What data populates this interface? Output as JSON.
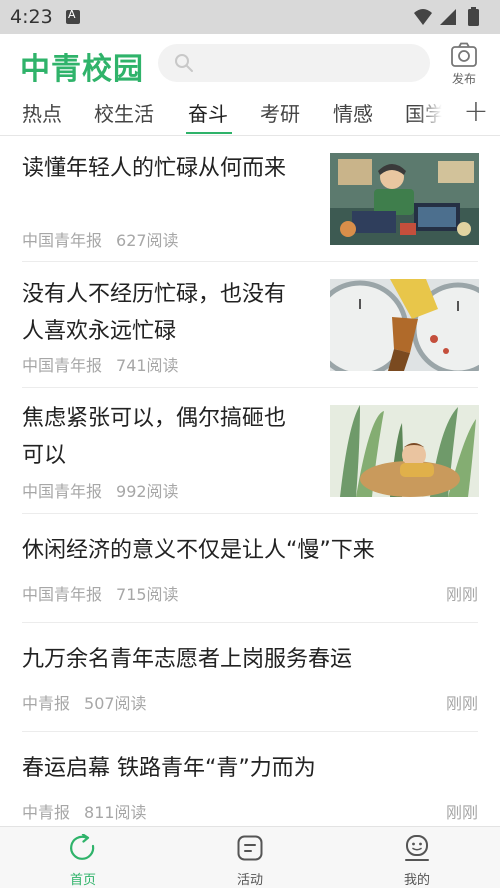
{
  "status_bar": {
    "time": "4:23"
  },
  "header": {
    "logo": "中青校园",
    "search_placeholder": "",
    "publish_label": "发布"
  },
  "tabs": [
    {
      "label": "热点"
    },
    {
      "label": "校生活"
    },
    {
      "label": "奋斗"
    },
    {
      "label": "考研"
    },
    {
      "label": "情感"
    },
    {
      "label": "国学"
    }
  ],
  "active_tab": "奋斗",
  "tab_add_label": "+",
  "articles": [
    {
      "title_lines": [
        "读懂年轻人的忙碌从何而来"
      ],
      "source": "中国青年报",
      "reads": "627阅读",
      "time": "",
      "has_image": true,
      "image": "illustration-desk-work"
    },
    {
      "title_lines": [
        "没有人不经历忙碌，也没有",
        "人喜欢永远忙碌"
      ],
      "source": "中国青年报",
      "reads": "741阅读",
      "time": "",
      "has_image": true,
      "image": "illustration-clock-person"
    },
    {
      "title_lines": [
        "焦虑紧张可以，偶尔搞砸也",
        "可以"
      ],
      "source": "中国青年报",
      "reads": "992阅读",
      "time": "",
      "has_image": true,
      "image": "illustration-relaxing-basket"
    },
    {
      "title_lines": [
        "休闲经济的意义不仅是让人“慢”下来"
      ],
      "source": "中国青年报",
      "reads": "715阅读",
      "time": "刚刚",
      "has_image": false
    },
    {
      "title_lines": [
        "九万余名青年志愿者上岗服务春运"
      ],
      "source": "中青报",
      "reads": "507阅读",
      "time": "刚刚",
      "has_image": false
    },
    {
      "title_lines": [
        "春运启幕 铁路青年“青”力而为"
      ],
      "source": "中青报",
      "reads": "811阅读",
      "time": "刚刚",
      "has_image": false
    }
  ],
  "bottom_nav": [
    {
      "label": "首页",
      "icon": "refresh-icon",
      "active": true
    },
    {
      "label": "活动",
      "icon": "note-icon",
      "active": false
    },
    {
      "label": "我的",
      "icon": "profile-icon",
      "active": false
    }
  ],
  "colors": {
    "brand": "#2fb36a",
    "meta": "#a7a7a7",
    "status_bar": "#d9d9d9"
  }
}
